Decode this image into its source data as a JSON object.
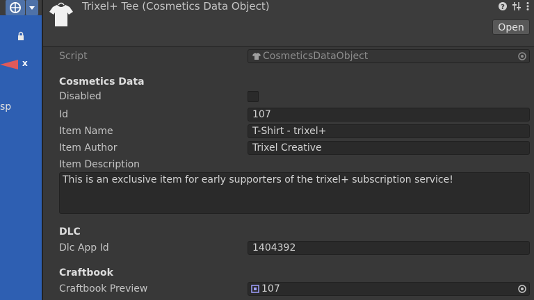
{
  "scene": {
    "axis_label": "x",
    "persp_label": "sp"
  },
  "header": {
    "title": "Trixel+ Tee (Cosmetics Data Object)",
    "open_label": "Open"
  },
  "inspector": {
    "script": {
      "label": "Script",
      "value": "CosmeticsDataObject"
    },
    "cosmetics_section": "Cosmetics Data",
    "disabled_label": "Disabled",
    "id": {
      "label": "Id",
      "value": "107"
    },
    "item_name": {
      "label": "Item Name",
      "value": "T-Shirt - trixel+"
    },
    "item_author": {
      "label": "Item Author",
      "value": "Trixel Creative"
    },
    "item_description": {
      "label": "Item Description",
      "value": "This is an exclusive item for early supporters of the trixel+ subscription service!"
    },
    "dlc_section": "DLC",
    "dlc_app_id": {
      "label": "Dlc App Id",
      "value": "1404392"
    },
    "craftbook_section": "Craftbook",
    "craftbook_preview": {
      "label": "Craftbook Preview",
      "value": "107"
    }
  },
  "colors": {
    "scene_blue": "#2e5fb2",
    "panel": "#383838",
    "axis_red": "#e05a5a"
  }
}
